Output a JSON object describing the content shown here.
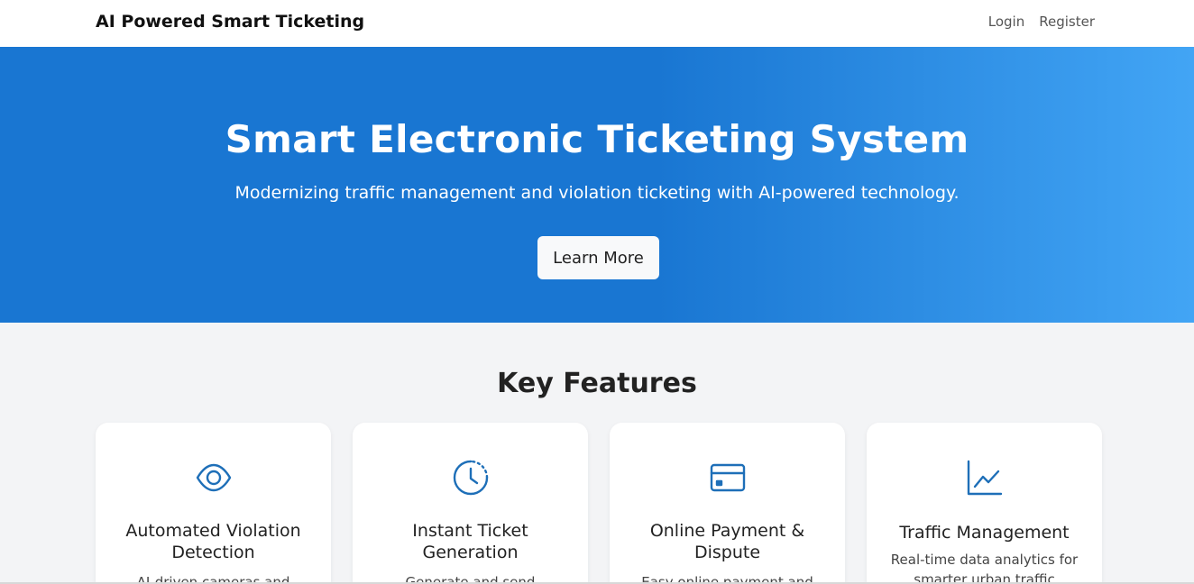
{
  "navbar": {
    "brand": "AI Powered Smart Ticketing",
    "links": [
      "Login",
      "Register"
    ]
  },
  "hero": {
    "title": "Smart Electronic Ticketing System",
    "subtitle": "Modernizing traffic management and violation ticketing with AI-powered technology.",
    "button_label": "Learn More"
  },
  "features": {
    "title": "Key Features",
    "cards": [
      {
        "icon": "eye-icon",
        "title": "Automated Violation Detection",
        "description": "AI-driven cameras and"
      },
      {
        "icon": "clock-icon",
        "title": "Instant Ticket Generation",
        "description": "Generate and send electronic"
      },
      {
        "icon": "credit-card-icon",
        "title": "Online Payment & Dispute",
        "description": "Easy online payment and"
      },
      {
        "icon": "chart-line-icon",
        "title": "Traffic Management",
        "description": "Real-time data analytics for smarter urban traffic"
      }
    ]
  },
  "colors": {
    "primary": "#1976d2",
    "gradient_end": "#42a5f5",
    "icon": "#1e6fb8"
  }
}
